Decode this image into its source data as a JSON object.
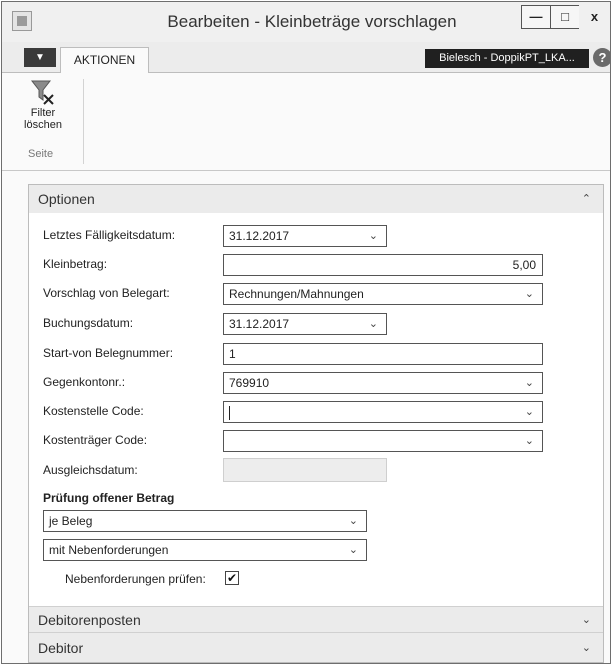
{
  "window": {
    "title": "Bearbeiten - Kleinbeträge vorschlagen",
    "minimize_glyph": "—",
    "maximize_glyph": "□",
    "close_glyph": "x"
  },
  "ribbon": {
    "menu_glyph": "▼",
    "tab_label": "AKTIONEN",
    "company": "Bielesch - DoppikPT_LKA...",
    "help_glyph": "?",
    "filter_button_line1": "Filter",
    "filter_button_line2": "löschen",
    "group_label": "Seite",
    "filter_icon": "filter-clear-icon"
  },
  "options": {
    "title": "Optionen",
    "collapse_glyph": "⌃",
    "fields": {
      "letztes_faelligkeitsdatum": {
        "label": "Letztes Fälligkeitsdatum:",
        "value": "31.12.2017"
      },
      "kleinbetrag": {
        "label": "Kleinbetrag:",
        "value": "5,00"
      },
      "vorschlag_belegart": {
        "label": "Vorschlag von Belegart:",
        "value": "Rechnungen/Mahnungen"
      },
      "buchungsdatum": {
        "label": "Buchungsdatum:",
        "value": "31.12.2017"
      },
      "start_belegnummer": {
        "label": "Start-von Belegnummer:",
        "value": "1"
      },
      "gegenkontonr": {
        "label": "Gegenkontonr.:",
        "value": "769910"
      },
      "kostenstelle": {
        "label": "Kostenstelle Code:",
        "value": ""
      },
      "kostentraeger": {
        "label": "Kostenträger Code:",
        "value": ""
      },
      "ausgleichsdatum": {
        "label": "Ausgleichsdatum:",
        "value": ""
      }
    },
    "pruefung": {
      "title": "Prüfung offener Betrag",
      "select1": "je Beleg",
      "select2": "mit Nebenforderungen",
      "checkbox_label": "Nebenforderungen prüfen:",
      "checkbox_glyph": "✔"
    }
  },
  "fasttabs": {
    "debitorenposten": "Debitorenposten",
    "debitor": "Debitor",
    "expand_glyph": "⌄"
  },
  "dropdown_glyph": "⌄"
}
